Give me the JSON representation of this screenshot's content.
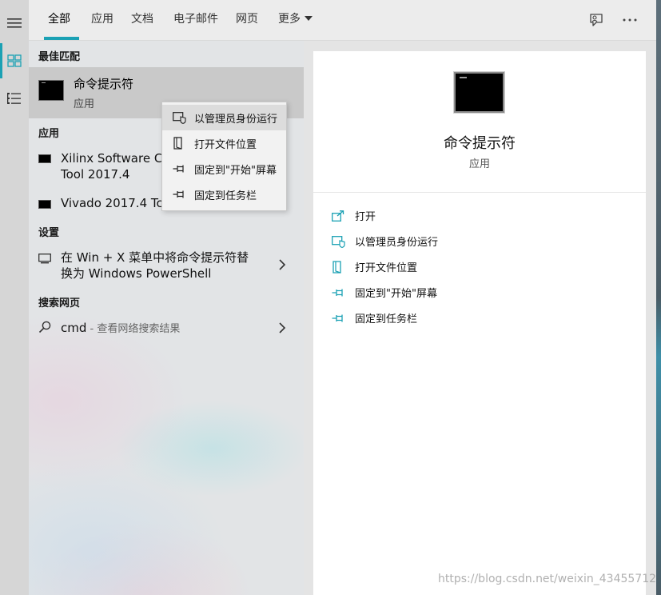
{
  "tabs": [
    {
      "label": "全部",
      "active": true
    },
    {
      "label": "应用"
    },
    {
      "label": "文档"
    },
    {
      "label": "电子邮件"
    },
    {
      "label": "网页"
    },
    {
      "label": "更多"
    }
  ],
  "tab_icons": {
    "feedback": "feedback-icon",
    "more_options": "ellipsis-icon"
  },
  "rail_icons": [
    "hamburger-menu-icon",
    "home-grid-icon",
    "list-icon"
  ],
  "results": {
    "best_match_header": "最佳匹配",
    "best_match": {
      "title": "命令提示符",
      "subtitle": "应用",
      "icon": "cmd-icon"
    },
    "apps_header": "应用",
    "apps": [
      {
        "line1": "Xilinx Software Co",
        "line2": "Tool 2017.4",
        "icon": "app-window-icon"
      },
      {
        "line1": "Vivado 2017.4 Tcl",
        "icon": "app-window-icon"
      }
    ],
    "settings_header": "设置",
    "settings": [
      {
        "line1": "在 Win + X 菜单中将命令提示符替",
        "line2": "换为 Windows PowerShell",
        "icon": "settings-monitor-icon"
      }
    ],
    "web_header": "搜索网页",
    "web": [
      {
        "query": "cmd",
        "suffix": " - 查看网络搜索结果",
        "icon": "search-icon"
      }
    ]
  },
  "context_menu": [
    {
      "label": "以管理员身份运行",
      "icon": "run-as-admin-icon",
      "hover": true
    },
    {
      "label": "打开文件位置",
      "icon": "file-location-icon"
    },
    {
      "label": "固定到\"开始\"屏幕",
      "icon": "pin-icon"
    },
    {
      "label": "固定到任务栏",
      "icon": "pin-icon"
    }
  ],
  "detail": {
    "title": "命令提示符",
    "subtitle": "应用",
    "icon": "cmd-icon",
    "actions": [
      {
        "label": "打开",
        "icon": "open-icon"
      },
      {
        "label": "以管理员身份运行",
        "icon": "run-as-admin-icon"
      },
      {
        "label": "打开文件位置",
        "icon": "file-location-icon"
      },
      {
        "label": "固定到\"开始\"屏幕",
        "icon": "pin-icon"
      },
      {
        "label": "固定到任务栏",
        "icon": "pin-icon"
      }
    ]
  },
  "colors": {
    "accent": "#1ba1b4",
    "selected_row": "#c9c9c9",
    "menu_hover": "#dcdcdc"
  },
  "watermark": "https://blog.csdn.net/weixin_43455712"
}
